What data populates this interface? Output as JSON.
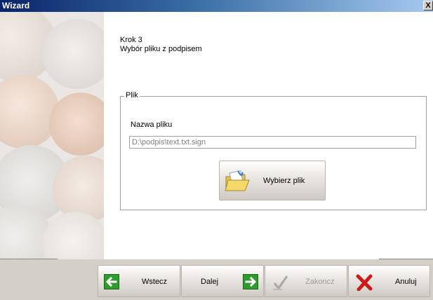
{
  "window": {
    "title": "Wizard",
    "close_label": "X"
  },
  "step": {
    "number": "Krok 3",
    "title": "Wybór pliku z podpisem"
  },
  "file_group": {
    "legend": "Plik",
    "filename_label": "Nazwa pliku",
    "filename_value": "D:\\podpis\\text.txt.sign",
    "choose_button_label": "Wybierz plik"
  },
  "buttons": {
    "back_label": "Wstecz",
    "next_label": "Dalej",
    "finish_label": "Zakoncz",
    "cancel_label": "Anuluj"
  },
  "colors": {
    "title_bar_start": "#0a246a",
    "title_bar_end": "#a6caf0",
    "arrow_green": "#2e9b2e",
    "cancel_red": "#cc1a1a",
    "dialog_gray": "#d4d0c8"
  }
}
